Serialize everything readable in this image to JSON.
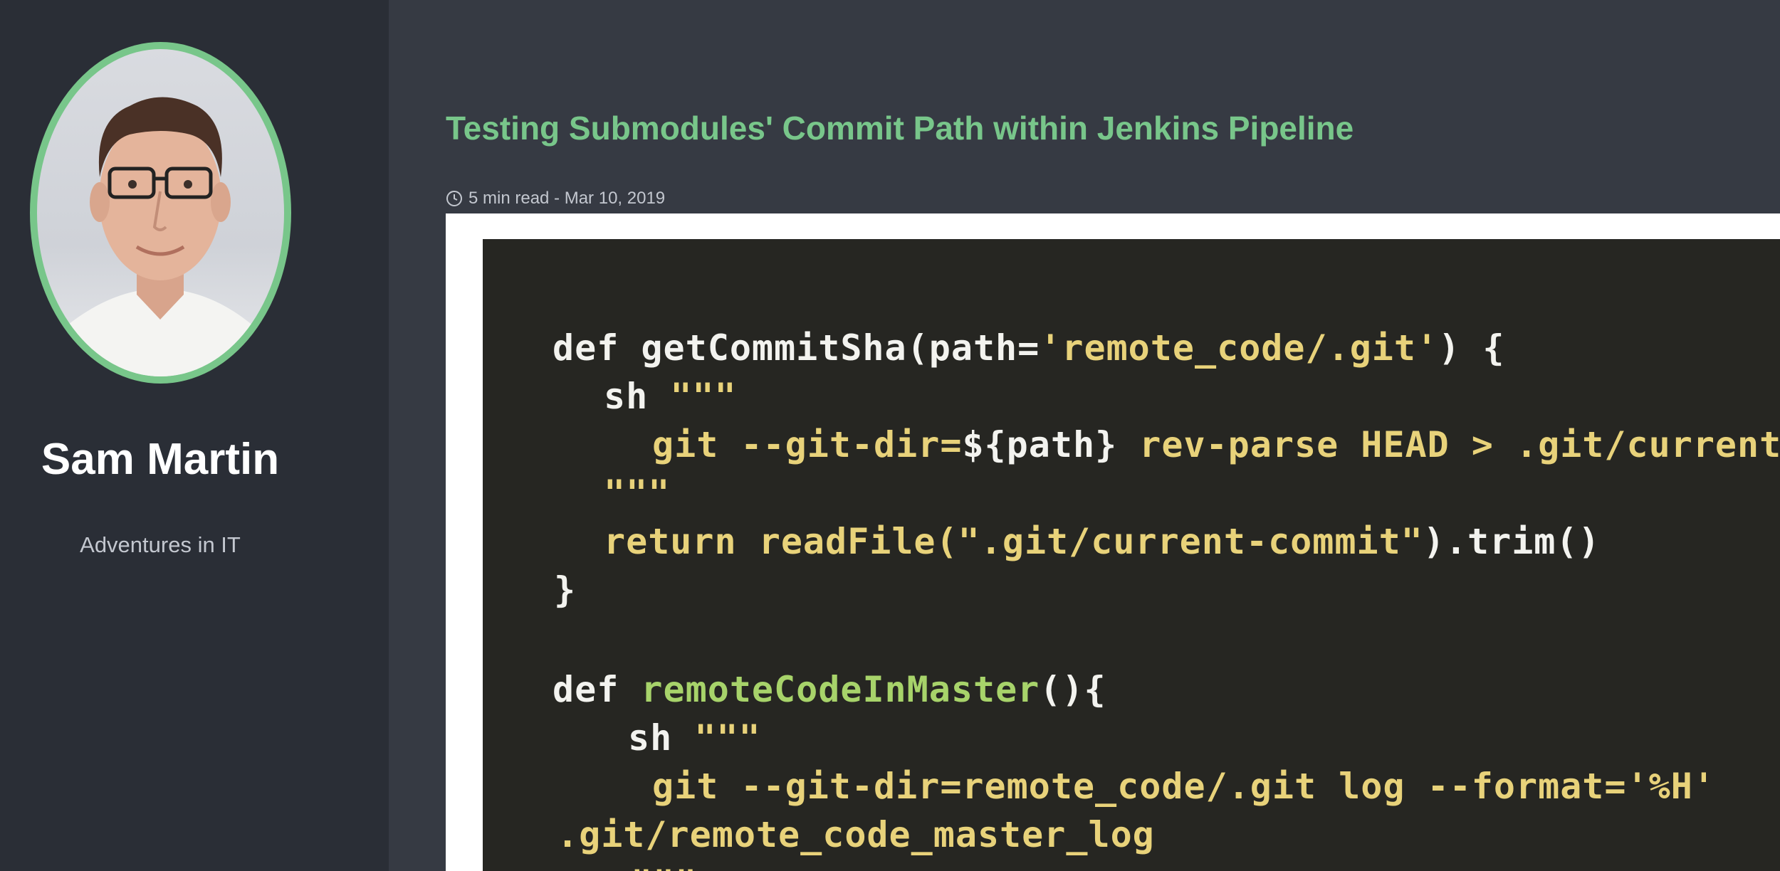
{
  "sidebar": {
    "author_name": "Sam Martin",
    "tagline": "Adventures in IT",
    "avatar_border_color": "#78c68a"
  },
  "post": {
    "title": "Testing Submodules' Commit Path within Jenkins Pipeline",
    "meta": "5 min read - Mar 10, 2019",
    "meta_icon": "clock-icon"
  },
  "code_image": {
    "lines": [
      [
        {
          "t": "def getCommitSha(path=",
          "c": "w"
        },
        {
          "t": "'remote_code/.git'",
          "c": "y"
        },
        {
          "t": ") {",
          "c": "w"
        }
      ],
      [
        {
          "t": "sh ",
          "c": "w"
        },
        {
          "t": "\"\"\"",
          "c": "y"
        }
      ],
      [
        {
          "t": "git --git-dir=",
          "c": "y"
        },
        {
          "t": "${path}",
          "c": "w"
        },
        {
          "t": " rev-parse HEAD > .git/current-commit",
          "c": "y"
        }
      ],
      [
        {
          "t": "\"\"\"",
          "c": "y"
        }
      ],
      [
        {
          "t": "return readFile(",
          "c": "y"
        },
        {
          "t": "\".git/current-commit\"",
          "c": "y"
        },
        {
          "t": ").trim()",
          "c": "w"
        }
      ],
      [
        {
          "t": "}",
          "c": "w"
        }
      ],
      [
        {
          "t": "def ",
          "c": "w"
        },
        {
          "t": "remoteCodeInMaster",
          "c": "g"
        },
        {
          "t": "(){",
          "c": "w"
        }
      ],
      [
        {
          "t": "sh ",
          "c": "w"
        },
        {
          "t": "\"\"\"",
          "c": "y"
        }
      ],
      [
        {
          "t": "git --git-dir=remote_code/.git log --format='%H'",
          "c": "y"
        }
      ],
      [
        {
          "t": ".git/remote_code_master_log",
          "c": "y"
        }
      ],
      [
        {
          "t": "\"\"\"",
          "c": "y"
        }
      ]
    ]
  }
}
